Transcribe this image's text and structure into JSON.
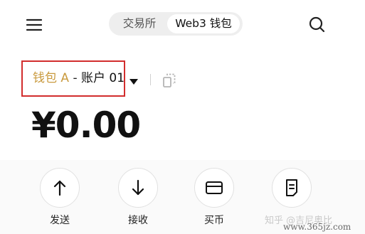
{
  "header": {
    "menu_icon": "hamburger-menu-icon",
    "tabs": [
      {
        "label": "交易所",
        "active": false
      },
      {
        "label": "Web3 钱包",
        "active": true
      }
    ],
    "search_icon": "search-icon"
  },
  "wallet": {
    "name": "钱包 A",
    "separator": " - ",
    "account": "账户 01",
    "caret_icon": "caret-down-icon",
    "copy_icon": "copy-icon",
    "highlight_color": "#d22d2d",
    "name_color": "#c99a3e"
  },
  "balance": {
    "amount": "¥0.00"
  },
  "actions": [
    {
      "label": "发送",
      "icon": "arrow-up-icon"
    },
    {
      "label": "接收",
      "icon": "arrow-down-icon"
    },
    {
      "label": "买币",
      "icon": "card-icon"
    },
    {
      "label": "",
      "icon": "document-icon"
    }
  ],
  "watermark": {
    "text": "知乎 @吉尼奥比",
    "url": "www.365jz.com"
  }
}
